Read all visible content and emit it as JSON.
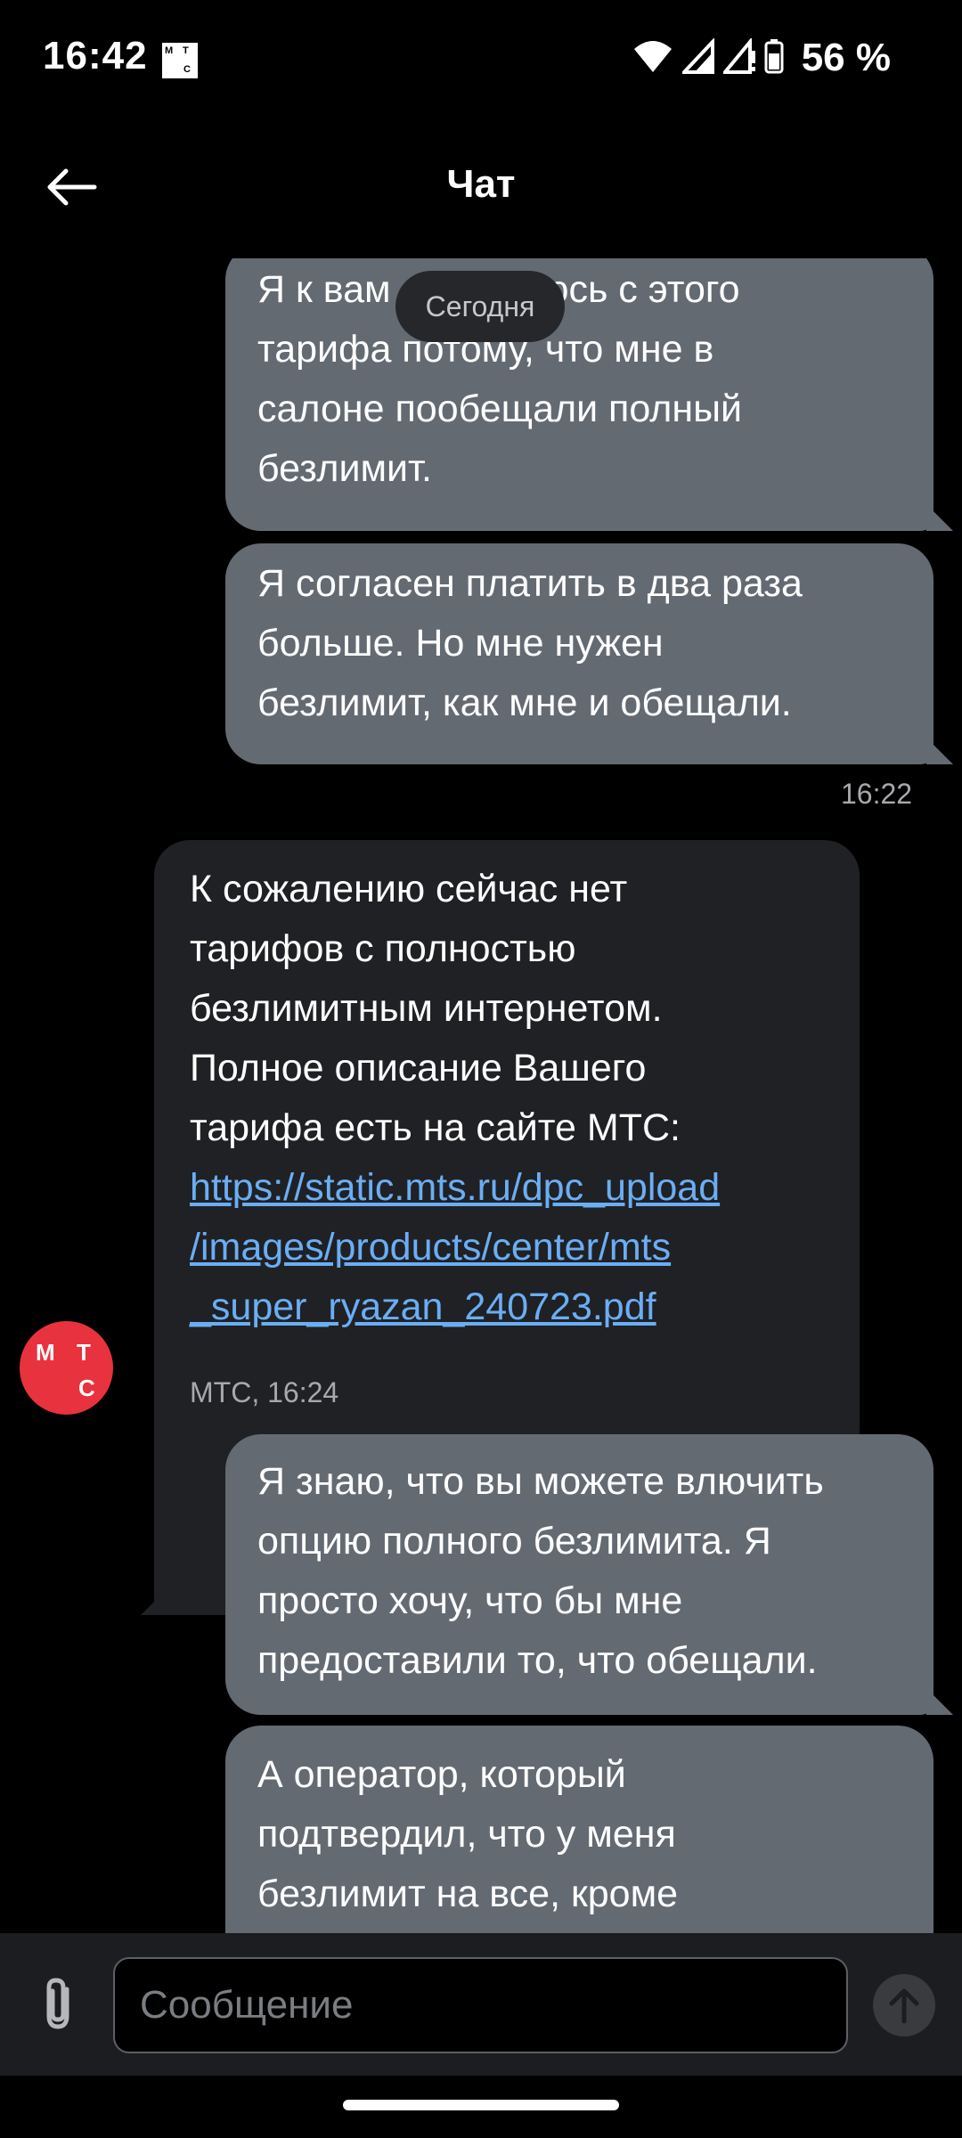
{
  "status_bar": {
    "time": "16:42",
    "carrier_logo": [
      "М",
      "Т",
      "С"
    ],
    "battery": "56 %",
    "icons": [
      "wifi-icon",
      "signal-icon",
      "signal-no-data-icon",
      "battery-icon"
    ]
  },
  "header": {
    "title": "Чат",
    "back_icon": "arrow-left-icon"
  },
  "chat": {
    "date_label": "Сегодня",
    "messages": [
      {
        "direction": "outgoing",
        "lines": [
          "Я к вам обращаюсь с этого",
          "тарифа потому, что мне в",
          "салоне пообещали полный",
          "безлимит."
        ]
      },
      {
        "direction": "outgoing",
        "lines": [
          "Я согласен платить в два раза",
          "больше. Но мне нужен",
          "безлимит, как мне и обещали."
        ],
        "time": "16:22"
      },
      {
        "direction": "incoming",
        "lines": [
          "К сожалению сейчас нет",
          "тарифов с полностью",
          "безлимитным интернетом.",
          "Полное описание Вашего",
          "тарифа есть на сайте МТС:"
        ],
        "link_lines": [
          "https://static.mts.ru/dpc_upload",
          "/images/products/center/mts",
          "_super_ryazan_240723.pdf"
        ],
        "meta": "МТС, 16:24",
        "avatar": [
          "М",
          "Т",
          "С"
        ]
      },
      {
        "direction": "outgoing",
        "lines": [
          "Я знаю, что вы можете влючить",
          "опцию полного безлимита. Я",
          "просто хочу, что бы мне",
          "предоставили то, что обещали."
        ]
      },
      {
        "direction": "outgoing",
        "lines": [
          "А оператор, который",
          "подтвердил, что у меня",
          "безлимит на все, кроме"
        ]
      }
    ]
  },
  "composer": {
    "placeholder": "Сообщение",
    "attach_icon": "paperclip-icon",
    "send_icon": "arrow-up-icon"
  },
  "colors": {
    "background": "#000000",
    "outgoing_bubble": "#646a72",
    "incoming_bubble": "#202124",
    "link": "#6aaef5",
    "avatar": "#e8323e"
  }
}
